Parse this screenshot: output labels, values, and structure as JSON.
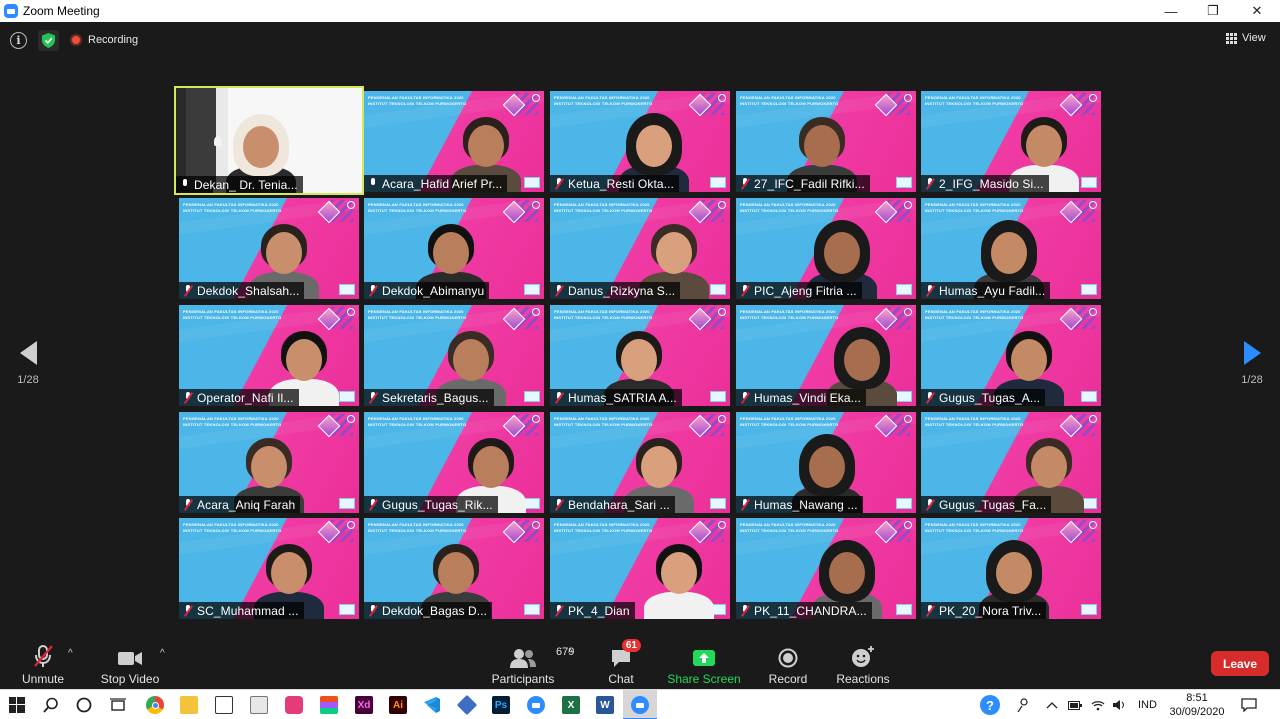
{
  "window": {
    "title": "Zoom Meeting",
    "minimize_glyph": "—",
    "restore_glyph": "❐",
    "close_glyph": "✕"
  },
  "topbar": {
    "info_glyph": "i",
    "recording_label": "Recording",
    "view_label": "View"
  },
  "gallery": {
    "banner_line1": "PENGENALAN FAKULTAS INFORMATIKA 2020",
    "banner_line2": "INSTITUT TEKNOLOGI TELKOM PURWOKERTO",
    "page_left": "1/28",
    "page_right": "1/28",
    "participants": [
      {
        "name": "Dekan_ Dr. Tenia...",
        "muted": false,
        "host": true
      },
      {
        "name": "Acara_Hafid Arief Pr...",
        "muted": false
      },
      {
        "name": "Ketua_Resti Okta...",
        "muted": true
      },
      {
        "name": "27_IFC_Fadil Rifki...",
        "muted": true
      },
      {
        "name": "2_IFG_Masido Si...",
        "muted": true
      },
      {
        "name": "Dekdok_Shalsah...",
        "muted": true
      },
      {
        "name": "Dekdok_Abimanyu",
        "muted": true
      },
      {
        "name": "Danus_Rizkyna S...",
        "muted": true
      },
      {
        "name": "PIC_Ajeng Fitria ...",
        "muted": true
      },
      {
        "name": "Humas_Ayu Fadil...",
        "muted": true
      },
      {
        "name": "Operator_Nafi Il...",
        "muted": true
      },
      {
        "name": "Sekretaris_Bagus...",
        "muted": true
      },
      {
        "name": "Humas_SATRIA A...",
        "muted": true
      },
      {
        "name": "Humas_Vindi Eka...",
        "muted": true
      },
      {
        "name": "Gugus_Tugas_A...",
        "muted": true
      },
      {
        "name": "Acara_Aniq Farah",
        "muted": true
      },
      {
        "name": "Gugus_Tugas_Rik...",
        "muted": true
      },
      {
        "name": "Bendahara_Sari ...",
        "muted": true
      },
      {
        "name": "Humas_Nawang ...",
        "muted": true
      },
      {
        "name": "Gugus_Tugas_Fa...",
        "muted": true
      },
      {
        "name": "SC_Muhammad ...",
        "muted": true
      },
      {
        "name": "Dekdok_Bagas D...",
        "muted": true
      },
      {
        "name": "PK_4_Dian",
        "muted": true
      },
      {
        "name": "PK_11_CHANDRA...",
        "muted": true
      },
      {
        "name": "PK_20_Nora Triv...",
        "muted": true
      }
    ]
  },
  "toolbar": {
    "unmute_label": "Unmute",
    "stop_video_label": "Stop Video",
    "participants_label": "Participants",
    "participants_count": "679",
    "chat_label": "Chat",
    "chat_badge": "61",
    "share_label": "Share Screen",
    "record_label": "Record",
    "reactions_label": "Reactions",
    "leave_label": "Leave",
    "caret": "^"
  },
  "taskbar": {
    "icons": [
      "windows-start-icon",
      "search-icon",
      "cortana-icon",
      "task-view-icon",
      "chrome-icon",
      "file-explorer-icon",
      "store-icon",
      "notepad-icon",
      "app-icon",
      "figma-icon",
      "xd-icon",
      "illustrator-icon",
      "vscode-icon",
      "virtualbox-icon",
      "photoshop-icon",
      "zoom-icon",
      "excel-icon",
      "word-icon",
      "zoom-active-icon"
    ],
    "xd_text": "Xd",
    "ai_text": "Ai",
    "ps_text": "Ps",
    "excel_text": "X",
    "word_text": "W",
    "language": "IND",
    "time": "8:51",
    "date": "30/09/2020"
  },
  "colors": {
    "zoom_blue": "#2d8cff",
    "share_green": "#23d959",
    "leave_red": "#d62c2c",
    "active_speaker": "#d6e85a",
    "muted_red": "#e0233b"
  }
}
